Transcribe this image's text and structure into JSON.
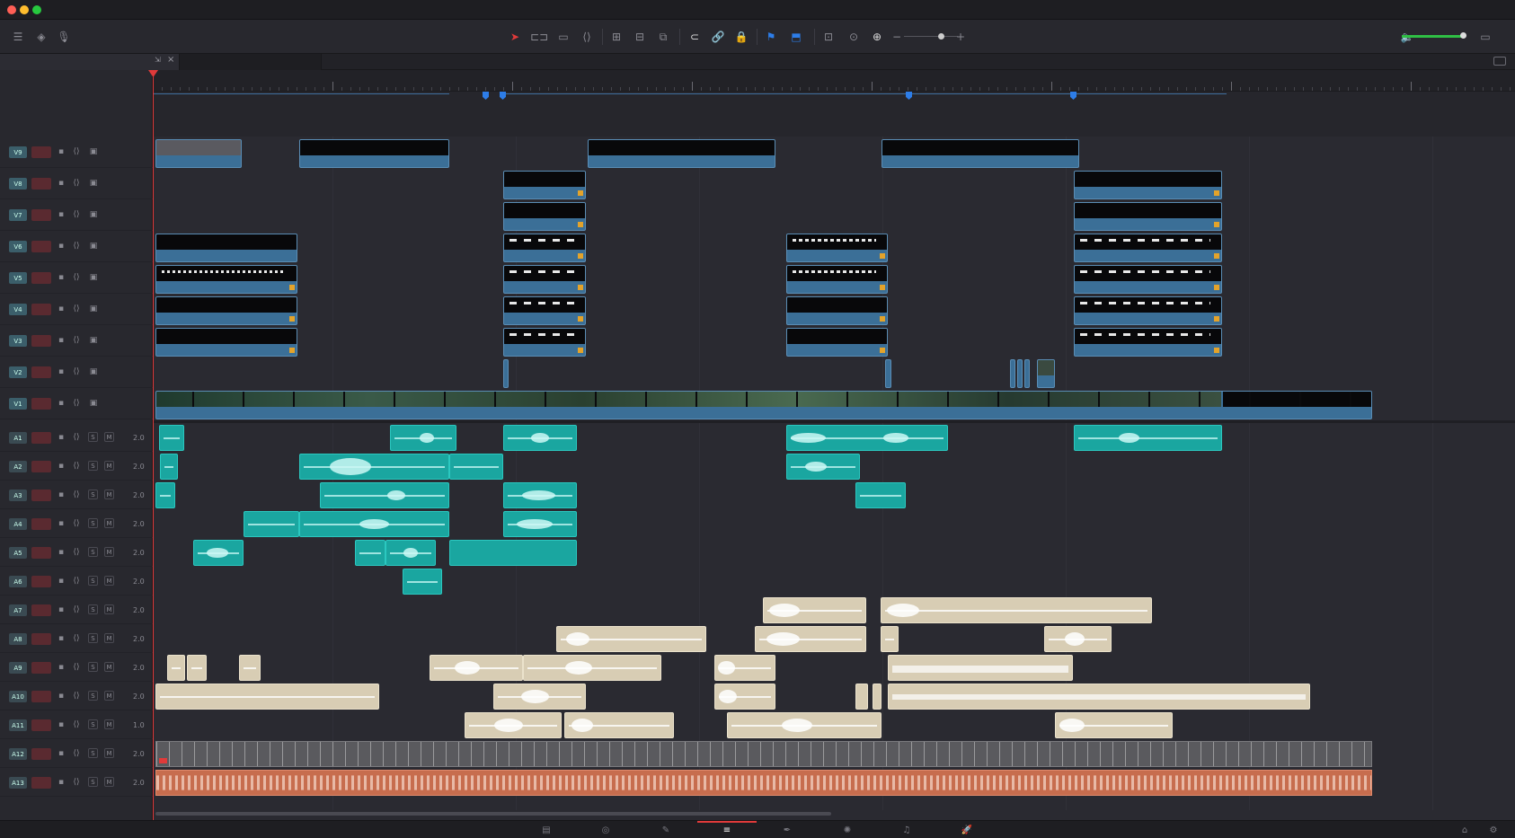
{
  "window": {
    "traffic_lights": {
      "close": "#ff5f56",
      "minimize": "#ffbd2e",
      "zoom": "#27c93f"
    }
  },
  "toolbar": {
    "left_icons": [
      "timeline-view-icon",
      "overlay-icon",
      "mic-icon"
    ],
    "tools": [
      "selection-icon",
      "trim-icon",
      "blade-icon",
      "dynamic-trim-icon",
      "insert-icon",
      "overwrite-icon",
      "replace-icon",
      "snap-icon",
      "link-icon",
      "lock-icon",
      "flag-icon",
      "marker-icon",
      "zoom-full-icon",
      "zoom-detail-icon",
      "zoom-custom-icon"
    ],
    "zoom": {
      "minus": "−",
      "plus": "+",
      "level": 0.67
    },
    "volume": {
      "icon": "speaker-icon",
      "level": 0.85
    }
  },
  "tabs": {
    "close_label": "×",
    "pin_label": "⇲"
  },
  "colors": {
    "playhead": "#e03a3a",
    "video_clip": "#3b6f97",
    "audio_clip": "#1aa6a0",
    "sfx_clip": "#d8cdb4",
    "music_clip": "#c76d4e",
    "marker": "#2d7de8",
    "flag": "#e3a32b"
  },
  "tracks": {
    "video": [
      {
        "id": "V9"
      },
      {
        "id": "V8"
      },
      {
        "id": "V7"
      },
      {
        "id": "V6"
      },
      {
        "id": "V5"
      },
      {
        "id": "V4"
      },
      {
        "id": "V3"
      },
      {
        "id": "V2"
      },
      {
        "id": "V1"
      }
    ],
    "audio": [
      {
        "id": "A1",
        "volume": "2.0"
      },
      {
        "id": "A2",
        "volume": "2.0"
      },
      {
        "id": "A3",
        "volume": "2.0"
      },
      {
        "id": "A4",
        "volume": "2.0"
      },
      {
        "id": "A5",
        "volume": "2.0"
      },
      {
        "id": "A6",
        "volume": "2.0"
      },
      {
        "id": "A7",
        "volume": "2.0"
      },
      {
        "id": "A8",
        "volume": "2.0"
      },
      {
        "id": "A9",
        "volume": "2.0"
      },
      {
        "id": "A10",
        "volume": "2.0"
      },
      {
        "id": "A11",
        "volume": "1.0"
      },
      {
        "id": "A12",
        "volume": "2.0"
      },
      {
        "id": "A13",
        "volume": "2.0"
      }
    ],
    "solo_label": "S",
    "mute_label": "M"
  },
  "pages": {
    "items": [
      "media-page-icon",
      "cut-page-icon",
      "edit-page-icon",
      "fusion-page-icon",
      "color-page-icon",
      "fairlight-page-icon",
      "deliver-page-icon"
    ],
    "active": "edit-page-icon",
    "home_icon": "home-icon",
    "settings_icon": "gear-icon"
  }
}
